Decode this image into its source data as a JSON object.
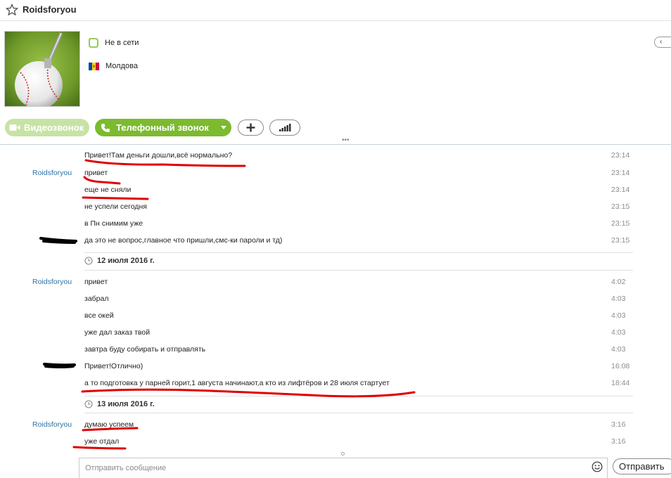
{
  "header": {
    "contact_name": "Roidsforyou",
    "star_icon": "star-outline-icon"
  },
  "profile": {
    "avatar_icon": "baseball-avatar",
    "status_icon": "offline-status-icon",
    "status": "Не в сети",
    "flag_icon": "moldova-flag-icon",
    "country": "Молдова",
    "collapse_label": "‹"
  },
  "call_bar": {
    "video_label": "Видеозвонок",
    "phone_label": "Телефонный звонок",
    "add_label": "+",
    "colors": {
      "video_disabled": "#c7e3a4",
      "phone": "#7cba2f"
    }
  },
  "messages": [
    {
      "sender": "",
      "text": "Привет!Там деньги дошли,всё нормально?",
      "time": "23:14"
    },
    {
      "sender": "Roidsforyou",
      "text": "привет",
      "time": "23:14"
    },
    {
      "sender": "",
      "text": "еще не сняли",
      "time": "23:14"
    },
    {
      "sender": "",
      "text": "не успели сегодня",
      "time": "23:15"
    },
    {
      "sender": "",
      "text": "в Пн снимим уже",
      "time": "23:15"
    },
    {
      "sender": "",
      "text": "да это не вопрос,главное что пришли,смс-ки пароли и тд)",
      "time": "23:15"
    },
    {
      "sender": "Roidsforyou",
      "text": "привет",
      "time": "4:02"
    },
    {
      "sender": "",
      "text": "забрал",
      "time": "4:03"
    },
    {
      "sender": "",
      "text": "все окей",
      "time": "4:03"
    },
    {
      "sender": "",
      "text": "уже дал заказ твой",
      "time": "4:03"
    },
    {
      "sender": "",
      "text": "завтра буду собирать и отправлять",
      "time": "4:03"
    },
    {
      "sender": "",
      "text": "Привет!Отлично)",
      "time": "16:08"
    },
    {
      "sender": "",
      "text": "а то подготовка у парней горит,1 августа начинают,а кто из лифтёров и 28 июля стартует",
      "time": "18:44"
    },
    {
      "sender": "Roidsforyou",
      "text": "думаю успеем",
      "time": "3:16"
    },
    {
      "sender": "",
      "text": "уже отдал",
      "time": "3:16"
    }
  ],
  "date_separators": [
    "12 июля 2016 г.",
    "13 июля 2016 г."
  ],
  "compose": {
    "placeholder": "Отправить сообщение",
    "send_label": "Отправить",
    "emoji_icon": "smiley-icon"
  },
  "annotations": {
    "underline_color": "#e00000",
    "scribble_color": "#000000"
  }
}
